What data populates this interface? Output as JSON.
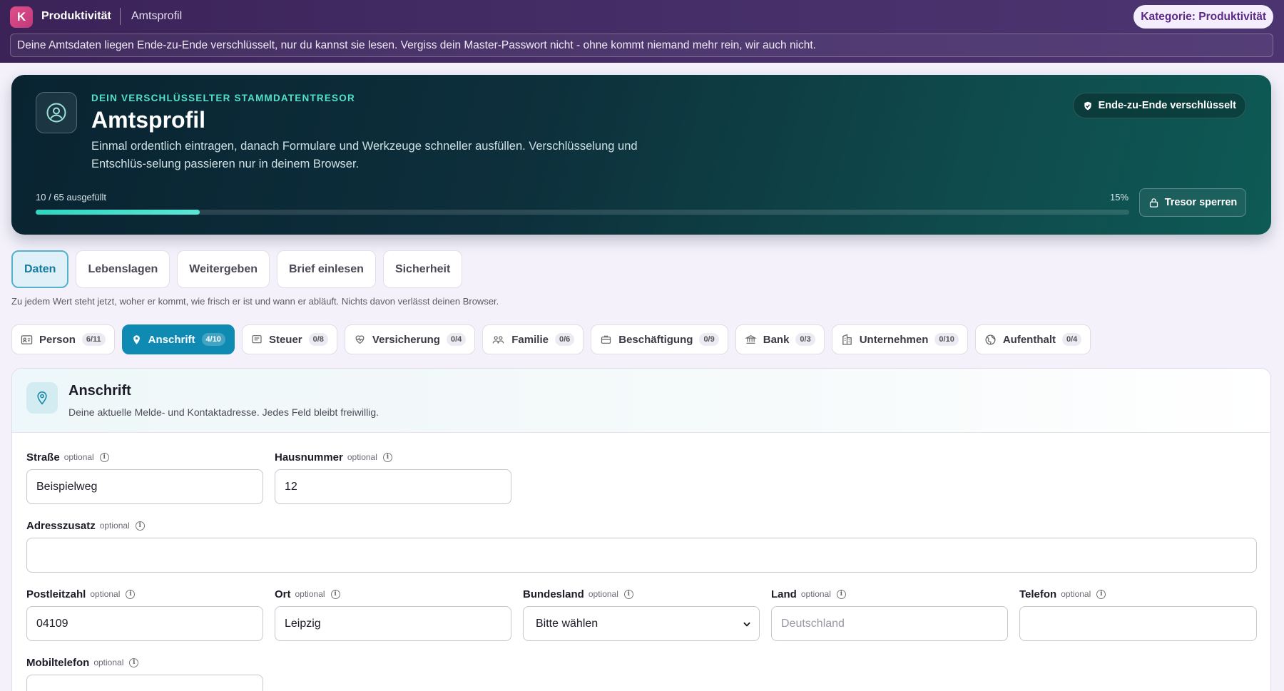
{
  "topbar": {
    "logo": "K",
    "app_title": "Produktivität",
    "page": "Amtsprofil",
    "category_pill": "Kategorie: Produktivität",
    "notice": "Deine Amtsdaten liegen Ende-zu-Ende verschlüsselt, nur du kannst sie lesen. Vergiss dein Master-Passwort nicht - ohne kommt niemand mehr rein, wir auch nicht."
  },
  "hero": {
    "kicker": "DEIN VERSCHLÜSSELTER STAMMDATENTRESOR",
    "title": "Amtsprofil",
    "description": "Einmal ordentlich eintragen, danach Formulare und Werkzeuge schneller ausfüllen. Verschlüsselung und Entschlüs-selung passieren nur in deinem Browser.",
    "badge": "Ende-zu-Ende verschlüsselt",
    "progress_label": "10 / 65 ausgefüllt",
    "progress_percent": "15%",
    "progress_value": 0.15,
    "lock_button": "Tresor sperren"
  },
  "main_tabs": [
    {
      "label": "Daten",
      "active": true
    },
    {
      "label": "Lebenslagen"
    },
    {
      "label": "Weitergeben"
    },
    {
      "label": "Brief einlesen"
    },
    {
      "label": "Sicherheit"
    }
  ],
  "tabs_hint": "Zu jedem Wert steht jetzt, woher er kommt, wie frisch er ist und wann er abläuft. Nichts davon verlässt deinen Browser.",
  "categories": [
    {
      "label": "Person",
      "count": "6/11",
      "icon": "id-card-icon"
    },
    {
      "label": "Anschrift",
      "count": "4/10",
      "icon": "location-pin-icon",
      "active": true
    },
    {
      "label": "Steuer",
      "count": "0/8",
      "icon": "receipt-icon"
    },
    {
      "label": "Versicherung",
      "count": "0/4",
      "icon": "heart-pulse-icon"
    },
    {
      "label": "Familie",
      "count": "0/6",
      "icon": "people-icon"
    },
    {
      "label": "Beschäftigung",
      "count": "0/9",
      "icon": "briefcase-icon"
    },
    {
      "label": "Bank",
      "count": "0/3",
      "icon": "bank-icon"
    },
    {
      "label": "Unternehmen",
      "count": "0/10",
      "icon": "building-icon"
    },
    {
      "label": "Aufenthalt",
      "count": "0/4",
      "icon": "globe-icon"
    }
  ],
  "section": {
    "title": "Anschrift",
    "subtitle": "Deine aktuelle Melde- und Kontaktadresse. Jedes Feld bleibt freiwillig.",
    "optional_label": "optional",
    "fields": {
      "strasse": {
        "label": "Straße",
        "value": "Beispielweg"
      },
      "hausnummer": {
        "label": "Hausnummer",
        "value": "12"
      },
      "adresszusatz": {
        "label": "Adresszusatz",
        "value": ""
      },
      "postleitzahl": {
        "label": "Postleitzahl",
        "value": "04109"
      },
      "ort": {
        "label": "Ort",
        "value": "Leipzig"
      },
      "bundesland": {
        "label": "Bundesland",
        "value": "Bitte wählen"
      },
      "land": {
        "label": "Land",
        "value": "",
        "placeholder": "Deutschland"
      },
      "telefon": {
        "label": "Telefon",
        "value": ""
      },
      "mobiltelefon": {
        "label": "Mobiltelefon",
        "value": ""
      }
    }
  },
  "colors": {
    "topbar": "#3b2358",
    "accent_teal": "#2ed6c0",
    "active_tab": "#0f8ab3"
  }
}
